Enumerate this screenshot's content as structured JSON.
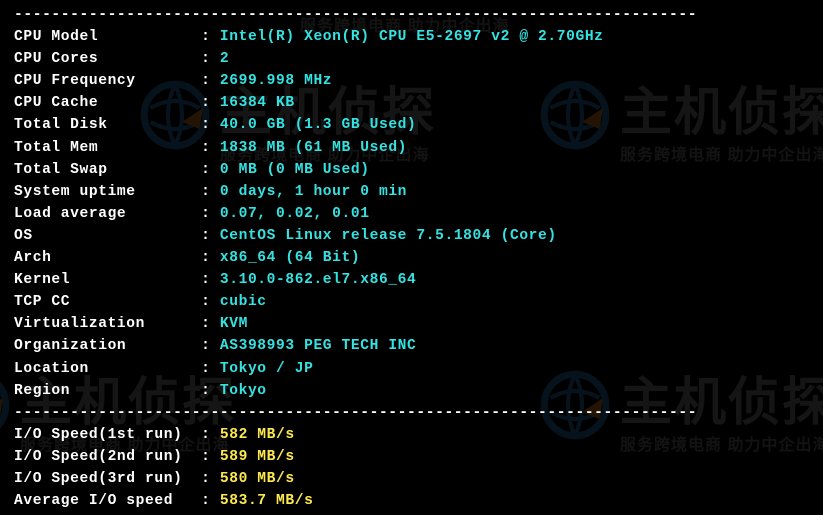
{
  "separator_top": "-------------------------------------------------------------------------",
  "specs": [
    {
      "label": "CPU Model",
      "value": "Intel(R) Xeon(R) CPU E5-2697 v2 @ 2.70GHz"
    },
    {
      "label": "CPU Cores",
      "value": "2"
    },
    {
      "label": "CPU Frequency",
      "value": "2699.998 MHz"
    },
    {
      "label": "CPU Cache",
      "value": "16384 KB"
    },
    {
      "label": "Total Disk",
      "value": "40.0 GB (1.3 GB Used)"
    },
    {
      "label": "Total Mem",
      "value": "1838 MB (61 MB Used)"
    },
    {
      "label": "Total Swap",
      "value": "0 MB (0 MB Used)"
    },
    {
      "label": "System uptime",
      "value": "0 days, 1 hour 0 min"
    },
    {
      "label": "Load average",
      "value": "0.07, 0.02, 0.01"
    },
    {
      "label": "OS",
      "value": "CentOS Linux release 7.5.1804 (Core)"
    },
    {
      "label": "Arch",
      "value": "x86_64 (64 Bit)"
    },
    {
      "label": "Kernel",
      "value": "3.10.0-862.el7.x86_64"
    },
    {
      "label": "TCP CC",
      "value": "cubic"
    },
    {
      "label": "Virtualization",
      "value": "KVM"
    },
    {
      "label": "Organization",
      "value": "AS398993 PEG TECH INC"
    },
    {
      "label": "Location",
      "value": "Tokyo / JP"
    },
    {
      "label": "Region",
      "value": "Tokyo"
    }
  ],
  "separator_mid": "-------------------------------------------------------------------------",
  "io": [
    {
      "label": "I/O Speed(1st run)",
      "value": "582 MB/s"
    },
    {
      "label": "I/O Speed(2nd run)",
      "value": "589 MB/s"
    },
    {
      "label": "I/O Speed(3rd run)",
      "value": "580 MB/s"
    },
    {
      "label": "Average I/O speed",
      "value": "583.7 MB/s"
    }
  ],
  "watermark": {
    "brand": "主机侦探",
    "tagline": "服务跨境电商 助力中企出海"
  },
  "colors": {
    "bg": "#000000",
    "text": "#ffffff",
    "cyan": "#34e2e2",
    "yellow": "#fce94f"
  },
  "layout": {
    "label_width": 20,
    "colon": ": "
  }
}
